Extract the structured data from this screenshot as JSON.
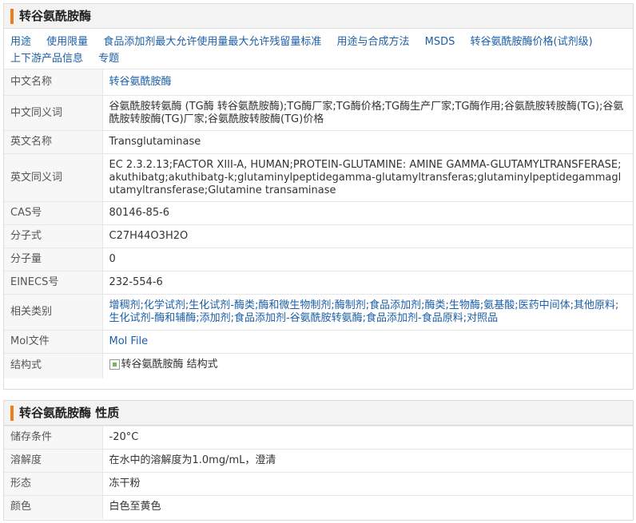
{
  "section1": {
    "title": "转谷氨酰胺酶",
    "nav_links": [
      "用途",
      "使用限量",
      "食品添加剂最大允许使用量最大允许残留量标准",
      "用途与合成方法",
      "MSDS",
      "转谷氨酰胺酶价格(试剂级)",
      "上下游产品信息",
      "专题"
    ],
    "rows": {
      "cn_name": {
        "label": "中文名称",
        "value": "转谷氨酰胺酶"
      },
      "cn_synonyms": {
        "label": "中文同义词",
        "value": "谷氨酰胺转氨酶 (TG酶 转谷氨酰胺酶);TG酶厂家;TG酶价格;TG酶生产厂家;TG酶作用;谷氨酰胺转胺酶(TG);谷氨酰胺转胺酶(TG)厂家;谷氨酰胺转胺酶(TG)价格"
      },
      "en_name": {
        "label": "英文名称",
        "value": "Transglutaminase"
      },
      "en_synonyms": {
        "label": "英文同义词",
        "value": "EC 2.3.2.13;FACTOR XIII-A, HUMAN;PROTEIN-GLUTAMINE: AMINE GAMMA-GLUTAMYLTRANSFERASE;akuthibatg;akuthibatg-k;glutaminylpeptidegamma-glutamyltransferas;glutaminylpeptidegammaglutamyltransferase;Glutamine transaminase"
      },
      "cas": {
        "label": "CAS号",
        "value": "80146-85-6"
      },
      "formula": {
        "label": "分子式",
        "value": "C27H44O3H2O"
      },
      "mw": {
        "label": "分子量",
        "value": "0"
      },
      "einecs": {
        "label": "EINECS号",
        "value": "232-554-6"
      },
      "category": {
        "label": "相关类别",
        "value": "增稠剂;化学试剂;生化试剂-酶类;酶和微生物制剂;酶制剂;食品添加剂;酶类;生物酶;氨基酸;医药中间体;其他原料;生化试剂-酶和辅酶;添加剂;食品添加剂-谷氨酰胺转氨酶;食品添加剂-食品原料;对照品"
      },
      "mol": {
        "label": "Mol文件",
        "value": "Mol File"
      },
      "structure": {
        "label": "结构式",
        "value": "转谷氨酰胺酶 结构式"
      }
    }
  },
  "section2": {
    "title": "转谷氨酰胺酶 性质",
    "rows": {
      "storage": {
        "label": "储存条件",
        "value": "-20°C"
      },
      "solubility": {
        "label": "溶解度",
        "value": "在水中的溶解度为1.0mg/mL，澄清"
      },
      "form": {
        "label": "形态",
        "value": "冻干粉"
      },
      "color": {
        "label": "颜色",
        "value": "白色至黄色"
      }
    }
  },
  "colors": {
    "accent_bar": "#ef7d1a",
    "link": "#1c5fa8"
  }
}
